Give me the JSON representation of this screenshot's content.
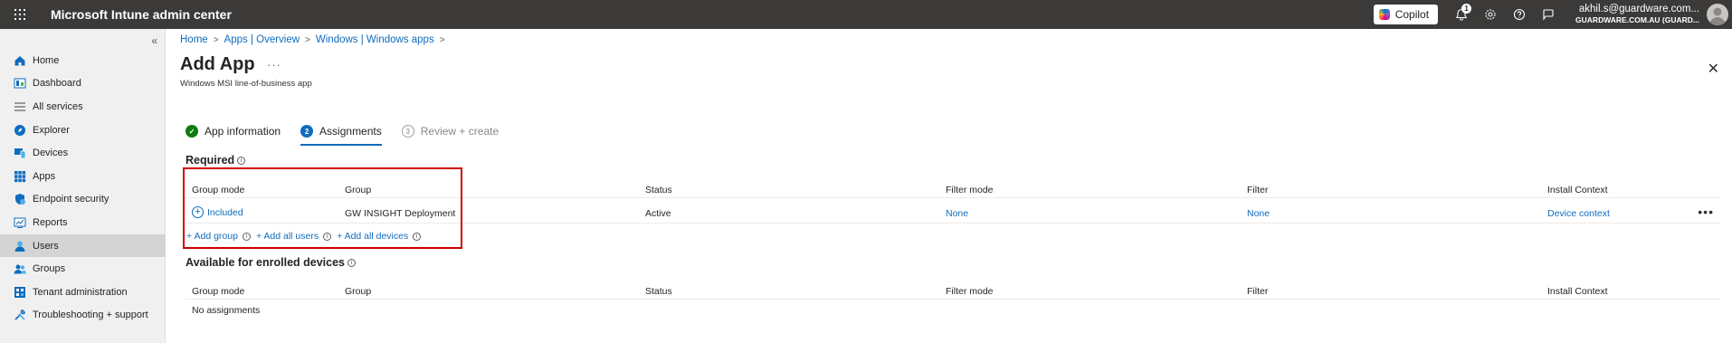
{
  "topbar": {
    "title": "Microsoft Intune admin center",
    "copilot_label": "Copilot",
    "notification_count": "1",
    "user_email": "akhil.s@guardware.com...",
    "user_tenant": "GUARDWARE.COM.AU (GUARD..."
  },
  "sidebar": {
    "collapse_label": "«",
    "items": [
      {
        "label": "Home",
        "icon": "home-icon"
      },
      {
        "label": "Dashboard",
        "icon": "dashboard-icon"
      },
      {
        "label": "All services",
        "icon": "list-icon"
      },
      {
        "label": "Explorer",
        "icon": "explorer-icon"
      },
      {
        "label": "Devices",
        "icon": "devices-icon"
      },
      {
        "label": "Apps",
        "icon": "apps-icon"
      },
      {
        "label": "Endpoint security",
        "icon": "shield-icon"
      },
      {
        "label": "Reports",
        "icon": "reports-icon"
      },
      {
        "label": "Users",
        "icon": "user-icon",
        "active": true
      },
      {
        "label": "Groups",
        "icon": "groups-icon"
      },
      {
        "label": "Tenant administration",
        "icon": "tenant-icon"
      },
      {
        "label": "Troubleshooting + support",
        "icon": "wrench-icon"
      }
    ]
  },
  "breadcrumb": [
    "Home",
    "Apps | Overview",
    "Windows | Windows apps"
  ],
  "page": {
    "title": "Add App",
    "more": "···",
    "subtitle": "Windows MSI line-of-business app"
  },
  "steps": [
    {
      "number": "✓",
      "label": "App information",
      "state": "done"
    },
    {
      "number": "2",
      "label": "Assignments",
      "state": "current"
    },
    {
      "number": "3",
      "label": "Review + create",
      "state": "future"
    }
  ],
  "required": {
    "title": "Required",
    "columns": [
      "Group mode",
      "Group",
      "Status",
      "Filter mode",
      "Filter",
      "Install Context"
    ],
    "rows": [
      {
        "group_mode": "Included",
        "group": "GW INSIGHT Deployment",
        "status": "Active",
        "filter_mode": "None",
        "filter": "None",
        "install_context": "Device context",
        "more": "•••"
      }
    ],
    "add_links": [
      "+ Add group",
      "+ Add all users",
      "+ Add all devices"
    ]
  },
  "available": {
    "title": "Available for enrolled devices",
    "columns": [
      "Group mode",
      "Group",
      "Status",
      "Filter mode",
      "Filter",
      "Install Context"
    ],
    "empty_text": "No assignments"
  },
  "colors": {
    "topbar": "#3b3a39",
    "link": "#0f6cbd",
    "highlight_border": "#d00000",
    "step_done": "#107c10"
  }
}
